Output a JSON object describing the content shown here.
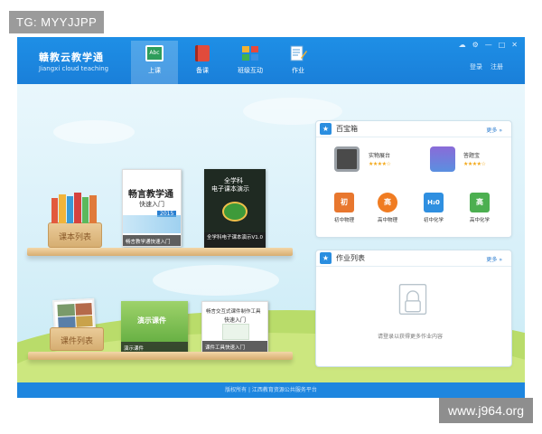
{
  "watermark_top": "TG: MYYJJPP",
  "watermark_bottom": "www.j964.org",
  "app": {
    "name_cn": "赣教云教学通",
    "name_en": "Jiangxi cloud teaching"
  },
  "nav": [
    {
      "label": "上课",
      "icon": "abc-board-icon",
      "active": true
    },
    {
      "label": "备课",
      "icon": "red-book-icon",
      "active": false
    },
    {
      "label": "班级互动",
      "icon": "blocks-icon",
      "active": false
    },
    {
      "label": "作业",
      "icon": "pencil-note-icon",
      "active": false
    }
  ],
  "account": {
    "login": "登录",
    "register": "注册"
  },
  "textbook_shelf": {
    "box_label": "课本列表",
    "book1": {
      "title": "畅言教学通",
      "subtitle": "快速入门",
      "year": "2015",
      "caption": "畅言教学通快速入门"
    },
    "book2": {
      "top": "全学科",
      "title": "电子课本演示",
      "caption": "全学科电子课本演示V1.0"
    }
  },
  "courseware_shelf": {
    "box_label": "课件列表",
    "book1": {
      "title": "演示课件",
      "caption": "演示课件"
    },
    "book2": {
      "title": "畅言交互式课件制作工具",
      "subtitle": "快速入门",
      "caption": "课件工具快速入门"
    }
  },
  "toolbox": {
    "title": "百宝箱",
    "more": "更多 »",
    "apps": [
      {
        "name": "实物展台",
        "icon": "document-camera-icon",
        "rating": "★★★★☆"
      },
      {
        "name": "答题宝",
        "icon": "quiz-kid-icon",
        "rating": "★★★★☆"
      }
    ],
    "subjects": [
      {
        "name": "初中物理",
        "glyph": "初",
        "color": "#e8772e"
      },
      {
        "name": "高中物理",
        "glyph": "高",
        "color": "#f07c22"
      },
      {
        "name": "初中化学",
        "glyph": "H₂0",
        "color": "#2f8fe0"
      },
      {
        "name": "高中化学",
        "glyph": "高",
        "color": "#4caf50"
      }
    ]
  },
  "homework": {
    "title": "作业列表",
    "more": "更多 »",
    "empty_hint": "请登录以获得更多作业内容"
  },
  "footer": "版权所有 | 江西教育资源公共服务平台"
}
